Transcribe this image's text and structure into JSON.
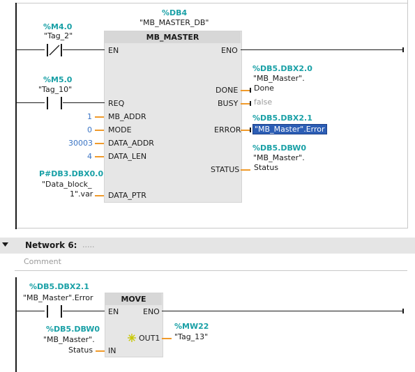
{
  "network5": {
    "instance_db_addr": "%DB4",
    "instance_db_name": "\"MB_MASTER_DB\"",
    "block_name": "MB_MASTER",
    "pin_en": "EN",
    "pin_eno": "ENO",
    "contact1": {
      "addr": "%M4.0",
      "name": "\"Tag_2\""
    },
    "contact2": {
      "addr": "%M5.0",
      "name": "\"Tag_10\""
    },
    "pin_req": "REQ",
    "pin_mb_addr": "MB_ADDR",
    "pin_mode": "MODE",
    "pin_data_addr": "DATA_ADDR",
    "pin_data_len": "DATA_LEN",
    "pin_data_ptr": "DATA_PTR",
    "val_mb_addr": "1",
    "val_mode": "0",
    "val_data_addr": "30003",
    "val_data_len": "4",
    "data_ptr_addr": "P#DB3.DBX0.0",
    "data_ptr_name_1": "\"Data_block_",
    "data_ptr_name_2": "1\".var",
    "pin_done": "DONE",
    "pin_busy": "BUSY",
    "pin_error": "ERROR",
    "pin_status": "STATUS",
    "done_addr": "%DB5.DBX2.0",
    "done_name_1": "\"MB_Master\".",
    "done_name_2": "Done",
    "busy_value": "false",
    "error_addr": "%DB5.DBX2.1",
    "error_name": "\"MB_Master\".Error",
    "status_addr": "%DB5.DBW0",
    "status_name_1": "\"MB_Master\".",
    "status_name_2": "Status"
  },
  "network6": {
    "title": "Network 6:",
    "title_dots": ".....",
    "comment_placeholder": "Comment",
    "block_name": "MOVE",
    "pin_en": "EN",
    "pin_eno": "ENO",
    "pin_in": "IN",
    "pin_out1": "OUT1",
    "contact": {
      "addr": "%DB5.DBX2.1",
      "name": "\"MB_Master\".Error"
    },
    "in_addr": "%DB5.DBW0",
    "in_name_1": "\"MB_Master\".",
    "in_name_2": "Status",
    "out_addr": "%MW22",
    "out_name": "\"Tag_13\""
  }
}
